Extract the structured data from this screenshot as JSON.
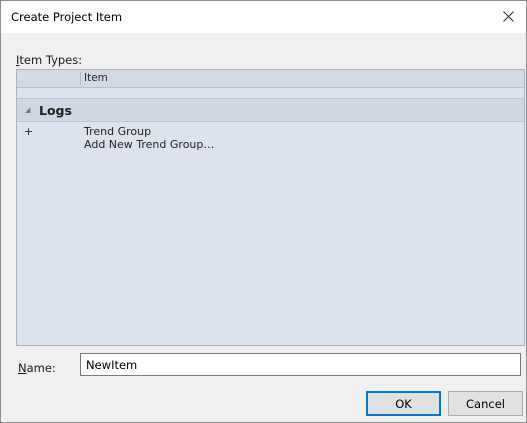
{
  "window": {
    "title": "Create Project Item",
    "close_icon": "close-icon"
  },
  "item_types": {
    "label_access_key": "I",
    "label_rest": "tem  Types:",
    "column_header": "Item",
    "group": {
      "name": "Logs",
      "expander_icon": "collapse-triangle-icon"
    },
    "rows": [
      {
        "expander": "+",
        "text": "Trend Group"
      },
      {
        "expander": "",
        "text": "Add New Trend Group…"
      }
    ]
  },
  "name_field": {
    "label_access_key": "N",
    "label_rest": "ame:",
    "value": "NewItem"
  },
  "buttons": {
    "ok_label": "OK",
    "cancel_label": "Cancel"
  },
  "colors": {
    "list_background": "#dde3ec",
    "default_button_border": "#0078d7"
  }
}
